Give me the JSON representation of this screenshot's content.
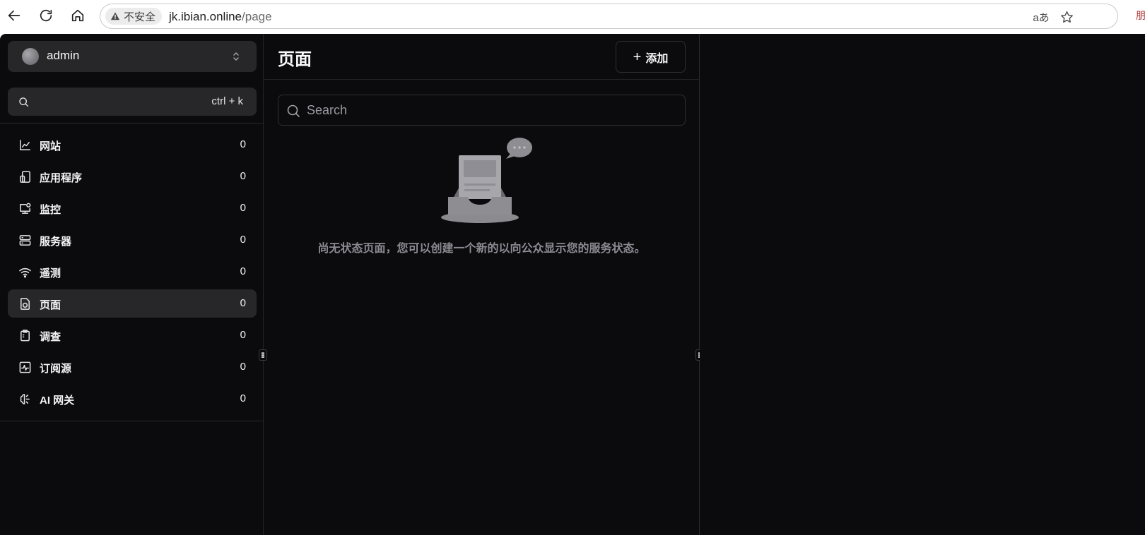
{
  "browser": {
    "security_label": "不安全",
    "url_host": "jk.ibian.online",
    "url_path": "/page",
    "read_aloud_icon": "aあ",
    "profile_stub": "朋"
  },
  "sidebar": {
    "account_name": "admin",
    "search_shortcut": "ctrl + k",
    "items": [
      {
        "label": "网站",
        "count": "0",
        "icon": "chart-icon"
      },
      {
        "label": "应用程序",
        "count": "0",
        "icon": "app-icon"
      },
      {
        "label": "监控",
        "count": "0",
        "icon": "monitor-icon"
      },
      {
        "label": "服务器",
        "count": "0",
        "icon": "server-icon"
      },
      {
        "label": "遥测",
        "count": "0",
        "icon": "wifi-icon"
      },
      {
        "label": "页面",
        "count": "0",
        "icon": "page-icon",
        "active": true
      },
      {
        "label": "调查",
        "count": "0",
        "icon": "clipboard-icon"
      },
      {
        "label": "订阅源",
        "count": "0",
        "icon": "pulse-icon"
      },
      {
        "label": "AI 网关",
        "count": "0",
        "icon": "brain-icon"
      }
    ]
  },
  "main": {
    "title": "页面",
    "add_label": "添加",
    "search_placeholder": "Search",
    "empty_message": "尚无状态页面，您可以创建一个新的以向公众显示您的服务状态。"
  }
}
